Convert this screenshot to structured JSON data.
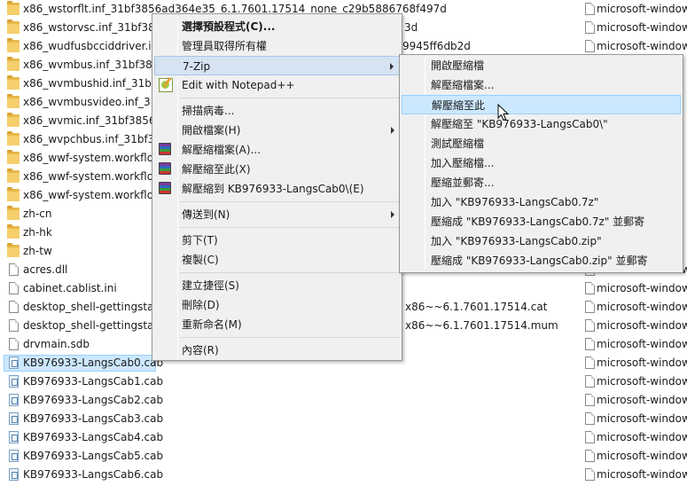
{
  "files": [
    {
      "type": "folder",
      "name": "x86_wstorflt.inf_31bf3856ad364e35_6.1.7601.17514_none_c29b5886768f497d"
    },
    {
      "type": "folder",
      "name": "x86_wstorvsc.inf_31bf3856"
    },
    {
      "type": "folder",
      "name": "x86_wudfusbcciddriver.inf"
    },
    {
      "type": "folder",
      "name": "x86_wvmbus.inf_31bf3856"
    },
    {
      "type": "folder",
      "name": "x86_wvmbushid.inf_31bf3"
    },
    {
      "type": "folder",
      "name": "x86_wvmbusvideo.inf_31b"
    },
    {
      "type": "folder",
      "name": "x86_wvmic.inf_31bf3856a"
    },
    {
      "type": "folder",
      "name": "x86_wvpchbus.inf_31bf38"
    },
    {
      "type": "folder",
      "name": "x86_wwf-system.workflow"
    },
    {
      "type": "folder",
      "name": "x86_wwf-system.workflow"
    },
    {
      "type": "folder",
      "name": "x86_wwf-system.workflow"
    },
    {
      "type": "folder",
      "name": "zh-cn"
    },
    {
      "type": "folder",
      "name": "zh-hk"
    },
    {
      "type": "folder",
      "name": "zh-tw"
    },
    {
      "type": "file",
      "name": "acres.dll"
    },
    {
      "type": "file",
      "name": "cabinet.cablist.ini"
    },
    {
      "type": "file",
      "name": "desktop_shell-gettingstart"
    },
    {
      "type": "file",
      "name": "desktop_shell-gettingstart"
    },
    {
      "type": "file",
      "name": "drvmain.sdb"
    },
    {
      "type": "cab",
      "name": "KB976933-LangsCab0.cab",
      "selected": true
    },
    {
      "type": "cab",
      "name": "KB976933-LangsCab1.cab"
    },
    {
      "type": "cab",
      "name": "KB976933-LangsCab2.cab"
    },
    {
      "type": "cab",
      "name": "KB976933-LangsCab3.cab"
    },
    {
      "type": "cab",
      "name": "KB976933-LangsCab4.cab"
    },
    {
      "type": "cab",
      "name": "KB976933-LangsCab5.cab"
    },
    {
      "type": "cab",
      "name": "KB976933-LangsCab6.cab"
    }
  ],
  "mid_fragments": {
    "row1": "3d",
    "row2": "9945ff6db2d",
    "row16": "x86~~6.1.7601.17514.cat",
    "row17": "x86~~6.1.7601.17514.mum"
  },
  "right_column_text": "microsoft-window",
  "context_menu": {
    "items": [
      {
        "label": "選擇預設程式(C)...",
        "bold": true
      },
      {
        "label": "管理員取得所有權"
      },
      {
        "label": "7-Zip",
        "submenu": true,
        "highlighted": true
      },
      {
        "label": "Edit with Notepad++",
        "icon": "notepad-plus-plus-icon"
      },
      {
        "separator": true
      },
      {
        "label": "掃描病毒..."
      },
      {
        "label": "開啟檔案(H)",
        "submenu": true
      },
      {
        "label": "解壓縮檔案(A)...",
        "icon": "winrar-icon"
      },
      {
        "label": "解壓縮至此(X)",
        "icon": "winrar-icon"
      },
      {
        "label": "解壓縮到 KB976933-LangsCab0\\(E)",
        "icon": "winrar-icon"
      },
      {
        "separator": true
      },
      {
        "label": "傳送到(N)",
        "submenu": true
      },
      {
        "separator": true
      },
      {
        "label": "剪下(T)"
      },
      {
        "label": "複製(C)"
      },
      {
        "separator": true
      },
      {
        "label": "建立捷徑(S)"
      },
      {
        "label": "刪除(D)"
      },
      {
        "label": "重新命名(M)"
      },
      {
        "separator": true
      },
      {
        "label": "內容(R)"
      }
    ]
  },
  "zip_submenu": {
    "items": [
      {
        "label": "開啟壓縮檔"
      },
      {
        "label": "解壓縮檔案..."
      },
      {
        "label": "解壓縮至此",
        "highlighted": true
      },
      {
        "label": "解壓縮至 \"KB976933-LangsCab0\\\""
      },
      {
        "label": "測試壓縮檔"
      },
      {
        "label": "加入壓縮檔..."
      },
      {
        "label": "壓縮並郵寄..."
      },
      {
        "label": "加入 \"KB976933-LangsCab0.7z\""
      },
      {
        "label": "壓縮成 \"KB976933-LangsCab0.7z\" 並郵寄"
      },
      {
        "label": "加入 \"KB976933-LangsCab0.zip\""
      },
      {
        "label": "壓縮成 \"KB976933-LangsCab0.zip\" 並郵寄"
      }
    ]
  },
  "colors": {
    "highlight": "#cce8ff",
    "menu_bg": "#f0f0f0",
    "folder": "#f5cf6b"
  }
}
